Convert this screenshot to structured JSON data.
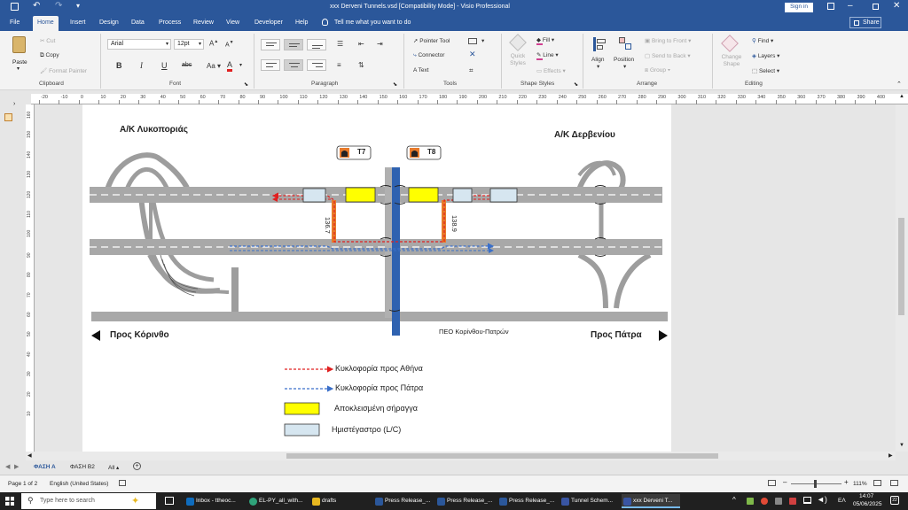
{
  "window": {
    "title": "xxx Derveni Tunnels.vsd  [Compatibility Mode]  -  Visio Professional",
    "sign_in": "Sign in",
    "share": "Share"
  },
  "tabs": [
    "File",
    "Home",
    "Insert",
    "Design",
    "Data",
    "Process",
    "Review",
    "View",
    "Developer",
    "Help"
  ],
  "tell_me": "Tell me what you want to do",
  "ribbon": {
    "clipboard": {
      "paste": "Paste",
      "cut": "Cut",
      "copy": "Copy",
      "format_painter": "Format Painter",
      "label": "Clipboard"
    },
    "font": {
      "name": "Arial",
      "size": "12pt",
      "label": "Font"
    },
    "paragraph": {
      "label": "Paragraph"
    },
    "tools": {
      "pointer": "Pointer Tool",
      "connector": "Connector",
      "text": "Text",
      "label": "Tools"
    },
    "shape_styles": {
      "quick_styles": "Quick Styles",
      "fill": "Fill",
      "line": "Line",
      "effects": "Effects",
      "label": "Shape Styles"
    },
    "arrange": {
      "align": "Align",
      "position": "Position",
      "bring_front": "Bring to Front",
      "send_back": "Send to Back",
      "group": "Group",
      "label": "Arrange"
    },
    "editing": {
      "change_shape": "Change Shape",
      "find": "Find",
      "layers": "Layers",
      "select": "Select",
      "label": "Editing"
    }
  },
  "ruler_numbers": [
    "-20",
    "-10",
    "0",
    "10",
    "20",
    "30",
    "40",
    "50",
    "60",
    "70",
    "80",
    "90",
    "100",
    "110",
    "120",
    "130",
    "140",
    "150",
    "160",
    "170",
    "180",
    "190",
    "200",
    "210",
    "220",
    "230",
    "240",
    "250",
    "260",
    "270",
    "280",
    "290",
    "300",
    "310",
    "320",
    "330",
    "340",
    "350",
    "360",
    "370",
    "380",
    "390",
    "400"
  ],
  "vruler_numbers": [
    "160",
    "150",
    "140",
    "130",
    "120",
    "110",
    "100",
    "90",
    "80",
    "70",
    "60",
    "50",
    "40",
    "30",
    "20",
    "10"
  ],
  "diagram": {
    "interchange_left": "Α/Κ Λυκοποριάς",
    "interchange_right": "Α/Κ Δερβενίου",
    "tunnel_t7": "T7",
    "tunnel_t8": "T8",
    "km_left": "136.7",
    "km_right": "138.9",
    "to_corinth": "Προς Κόρινθο",
    "to_patra": "Προς Πάτρα",
    "road_name": "ΠΕΟ Κορίνθου-Πατρών"
  },
  "legend": [
    {
      "label": "Κυκλοφορία προς Αθήνα",
      "color": "#e02020"
    },
    {
      "label": "Κυκλοφορία προς Πάτρα",
      "color": "#3a6fc9"
    },
    {
      "label": "Αποκλεισμένη σήραγγα",
      "color": "#ffff00"
    },
    {
      "label": "Ημιστέγαστρο (L/C)",
      "color": "#d6e6f0"
    }
  ],
  "sheets": {
    "tab1": "ΦΑΣΗ Α",
    "tab2": "ΦΑΣΗ Β2",
    "all": "All"
  },
  "status": {
    "page": "Page 1 of 2",
    "language": "English (United States)",
    "zoom": "111%"
  },
  "taskbar": {
    "search": "Type here to search",
    "items": [
      "Inbox - ttheoc...",
      "EL-PY_all_with...",
      "drafts",
      "Press Release_...",
      "Press Release_...",
      "Press Release_...",
      "Tunnel Schem...",
      "xxx Derveni T..."
    ],
    "lang": "ΕΛ",
    "time": "14:07",
    "date": "05/06/2025"
  }
}
